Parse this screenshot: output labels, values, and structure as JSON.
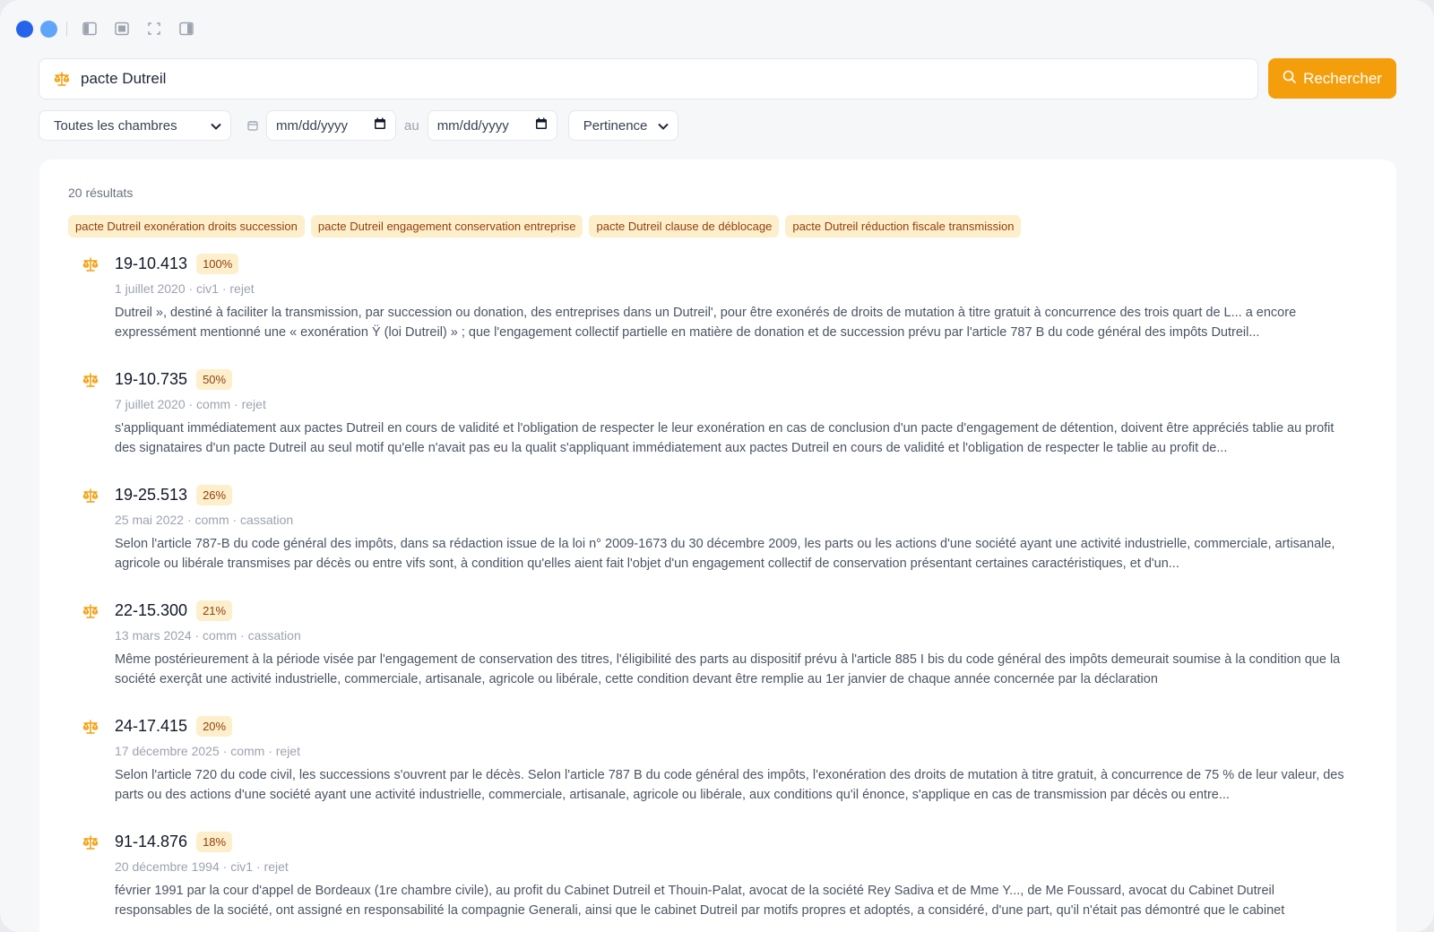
{
  "window_controls": {
    "icons": [
      "sidebar-left-icon",
      "panel-icon",
      "fullscreen-icon",
      "sidebar-right-icon"
    ]
  },
  "search": {
    "value": "pacte Dutreil",
    "button_label": "Rechercher"
  },
  "filters": {
    "chamber": "Toutes les chambres",
    "date_from_placeholder": "mm/dd/yyyy",
    "date_to_placeholder": "mm/dd/yyyy",
    "date_separator": "au",
    "sort": "Pertinence"
  },
  "results": {
    "count_label": "20 résultats",
    "suggestions": [
      "pacte Dutreil exonération droits succession",
      "pacte Dutreil engagement conservation entreprise",
      "pacte Dutreil clause de déblocage",
      "pacte Dutreil réduction fiscale transmission"
    ],
    "items": [
      {
        "title": "19-10.413",
        "score": "100%",
        "meta": "1 juillet 2020 · civ1 · rejet",
        "snippet": "Dutreil », destiné à faciliter la transmission, par succession ou donation, des entreprises dans un Dutreil', pour être exonérés de droits de mutation à titre gratuit à concurrence des trois quart de L... a encore expressément mentionné une « exonération Ÿ (loi Dutreil) » ; que l'engagement collectif partielle en matière de donation et de succession prévu par l'article 787 B du code général des impôts Dutreil..."
      },
      {
        "title": "19-10.735",
        "score": "50%",
        "meta": "7 juillet 2020 · comm · rejet",
        "snippet": "s'appliquant immédiatement aux pactes Dutreil en cours de validité et l'obligation de respecter le leur exonération en cas de conclusion d'un pacte d'engagement de détention, doivent être appréciés tablie au profit des signataires d'un pacte Dutreil au seul motif qu'elle n'avait pas eu la qualit s'appliquant immédiatement aux pactes Dutreil en cours de validité et l'obligation de respecter le tablie au profit de..."
      },
      {
        "title": "19-25.513",
        "score": "26%",
        "meta": "25 mai 2022 · comm · cassation",
        "snippet": "Selon l'article 787-B du code général des impôts, dans sa rédaction issue de la loi n° 2009-1673 du 30 décembre 2009, les parts ou les actions d'une société ayant une activité industrielle, commerciale, artisanale, agricole ou libérale transmises par décès ou entre vifs sont, à condition qu'elles aient fait l'objet d'un engagement collectif de conservation présentant certaines caractéristiques, et d'un..."
      },
      {
        "title": "22-15.300",
        "score": "21%",
        "meta": "13 mars 2024 · comm · cassation",
        "snippet": "Même postérieurement à la période visée par l'engagement de conservation des titres, l'éligibilité des parts au dispositif prévu à l'article 885 I bis du code général des impôts demeurait soumise à la condition que la société exerçât une activité industrielle, commerciale, artisanale, agricole ou libérale, cette condition devant être remplie au 1er janvier de chaque année concernée par la déclaration"
      },
      {
        "title": "24-17.415",
        "score": "20%",
        "meta": "17 décembre 2025 · comm · rejet",
        "snippet": "Selon l'article 720 du code civil, les successions s'ouvrent par le décès. Selon l'article 787 B du code général des impôts, l'exonération des droits de mutation à titre gratuit, à concurrence de 75 % de leur valeur, des parts ou des actions d'une société ayant une activité industrielle, commerciale, artisanale, agricole ou libérale, aux conditions qu'il énonce, s'applique en cas de transmission par décès ou entre..."
      },
      {
        "title": "91-14.876",
        "score": "18%",
        "meta": "20 décembre 1994 · civ1 · rejet",
        "snippet": "février 1991 par la cour d'appel de Bordeaux (1re chambre civile), au profit du Cabinet Dutreil et Thouin-Palat, avocat de la société Rey Sadiva et de Mme Y..., de Me Foussard, avocat du Cabinet Dutreil responsables de la société, ont assigné en responsabilité la compagnie Generali, ainsi que le cabinet Dutreil par motifs propres et adoptés, a considéré, d'une part, qu'il n'était pas démontré que le cabinet"
      }
    ]
  },
  "colors": {
    "accent": "#f59e0b",
    "chip_bg": "#fdefcb",
    "chip_text": "#92400e",
    "primary_dot": "#2563eb",
    "secondary_dot": "#60a5fa"
  }
}
